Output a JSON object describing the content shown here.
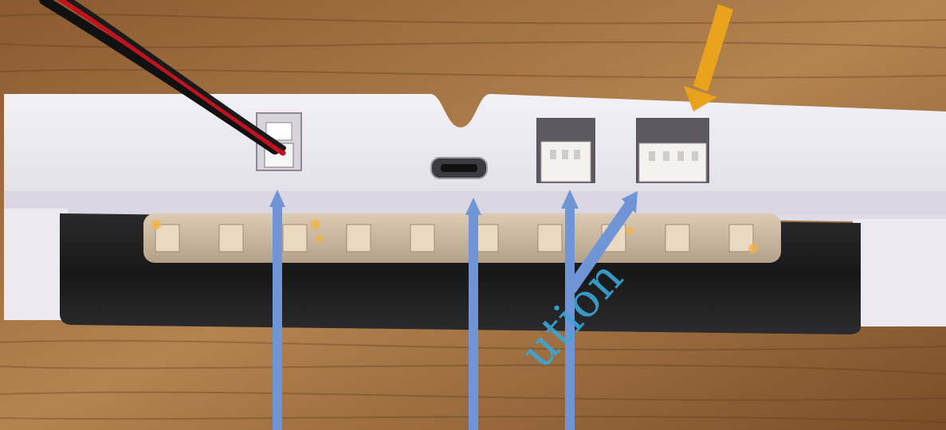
{
  "watermark": {
    "text": "ution"
  },
  "colors": {
    "wood_light": "#a8784a",
    "wood_dark": "#6e4424",
    "housing": "#e9e7ef",
    "housing_shadow": "#cfcbd8",
    "led_bar": "#1f1f21",
    "led_strip": "#c9b8a2",
    "arrow_blue": "#6f95d6",
    "arrow_orange": "#e9a21b"
  },
  "arrows": {
    "blue": {
      "count": 4,
      "color_name": "blue-arrow"
    },
    "orange": {
      "count": 1,
      "color_name": "orange-arrow"
    }
  }
}
